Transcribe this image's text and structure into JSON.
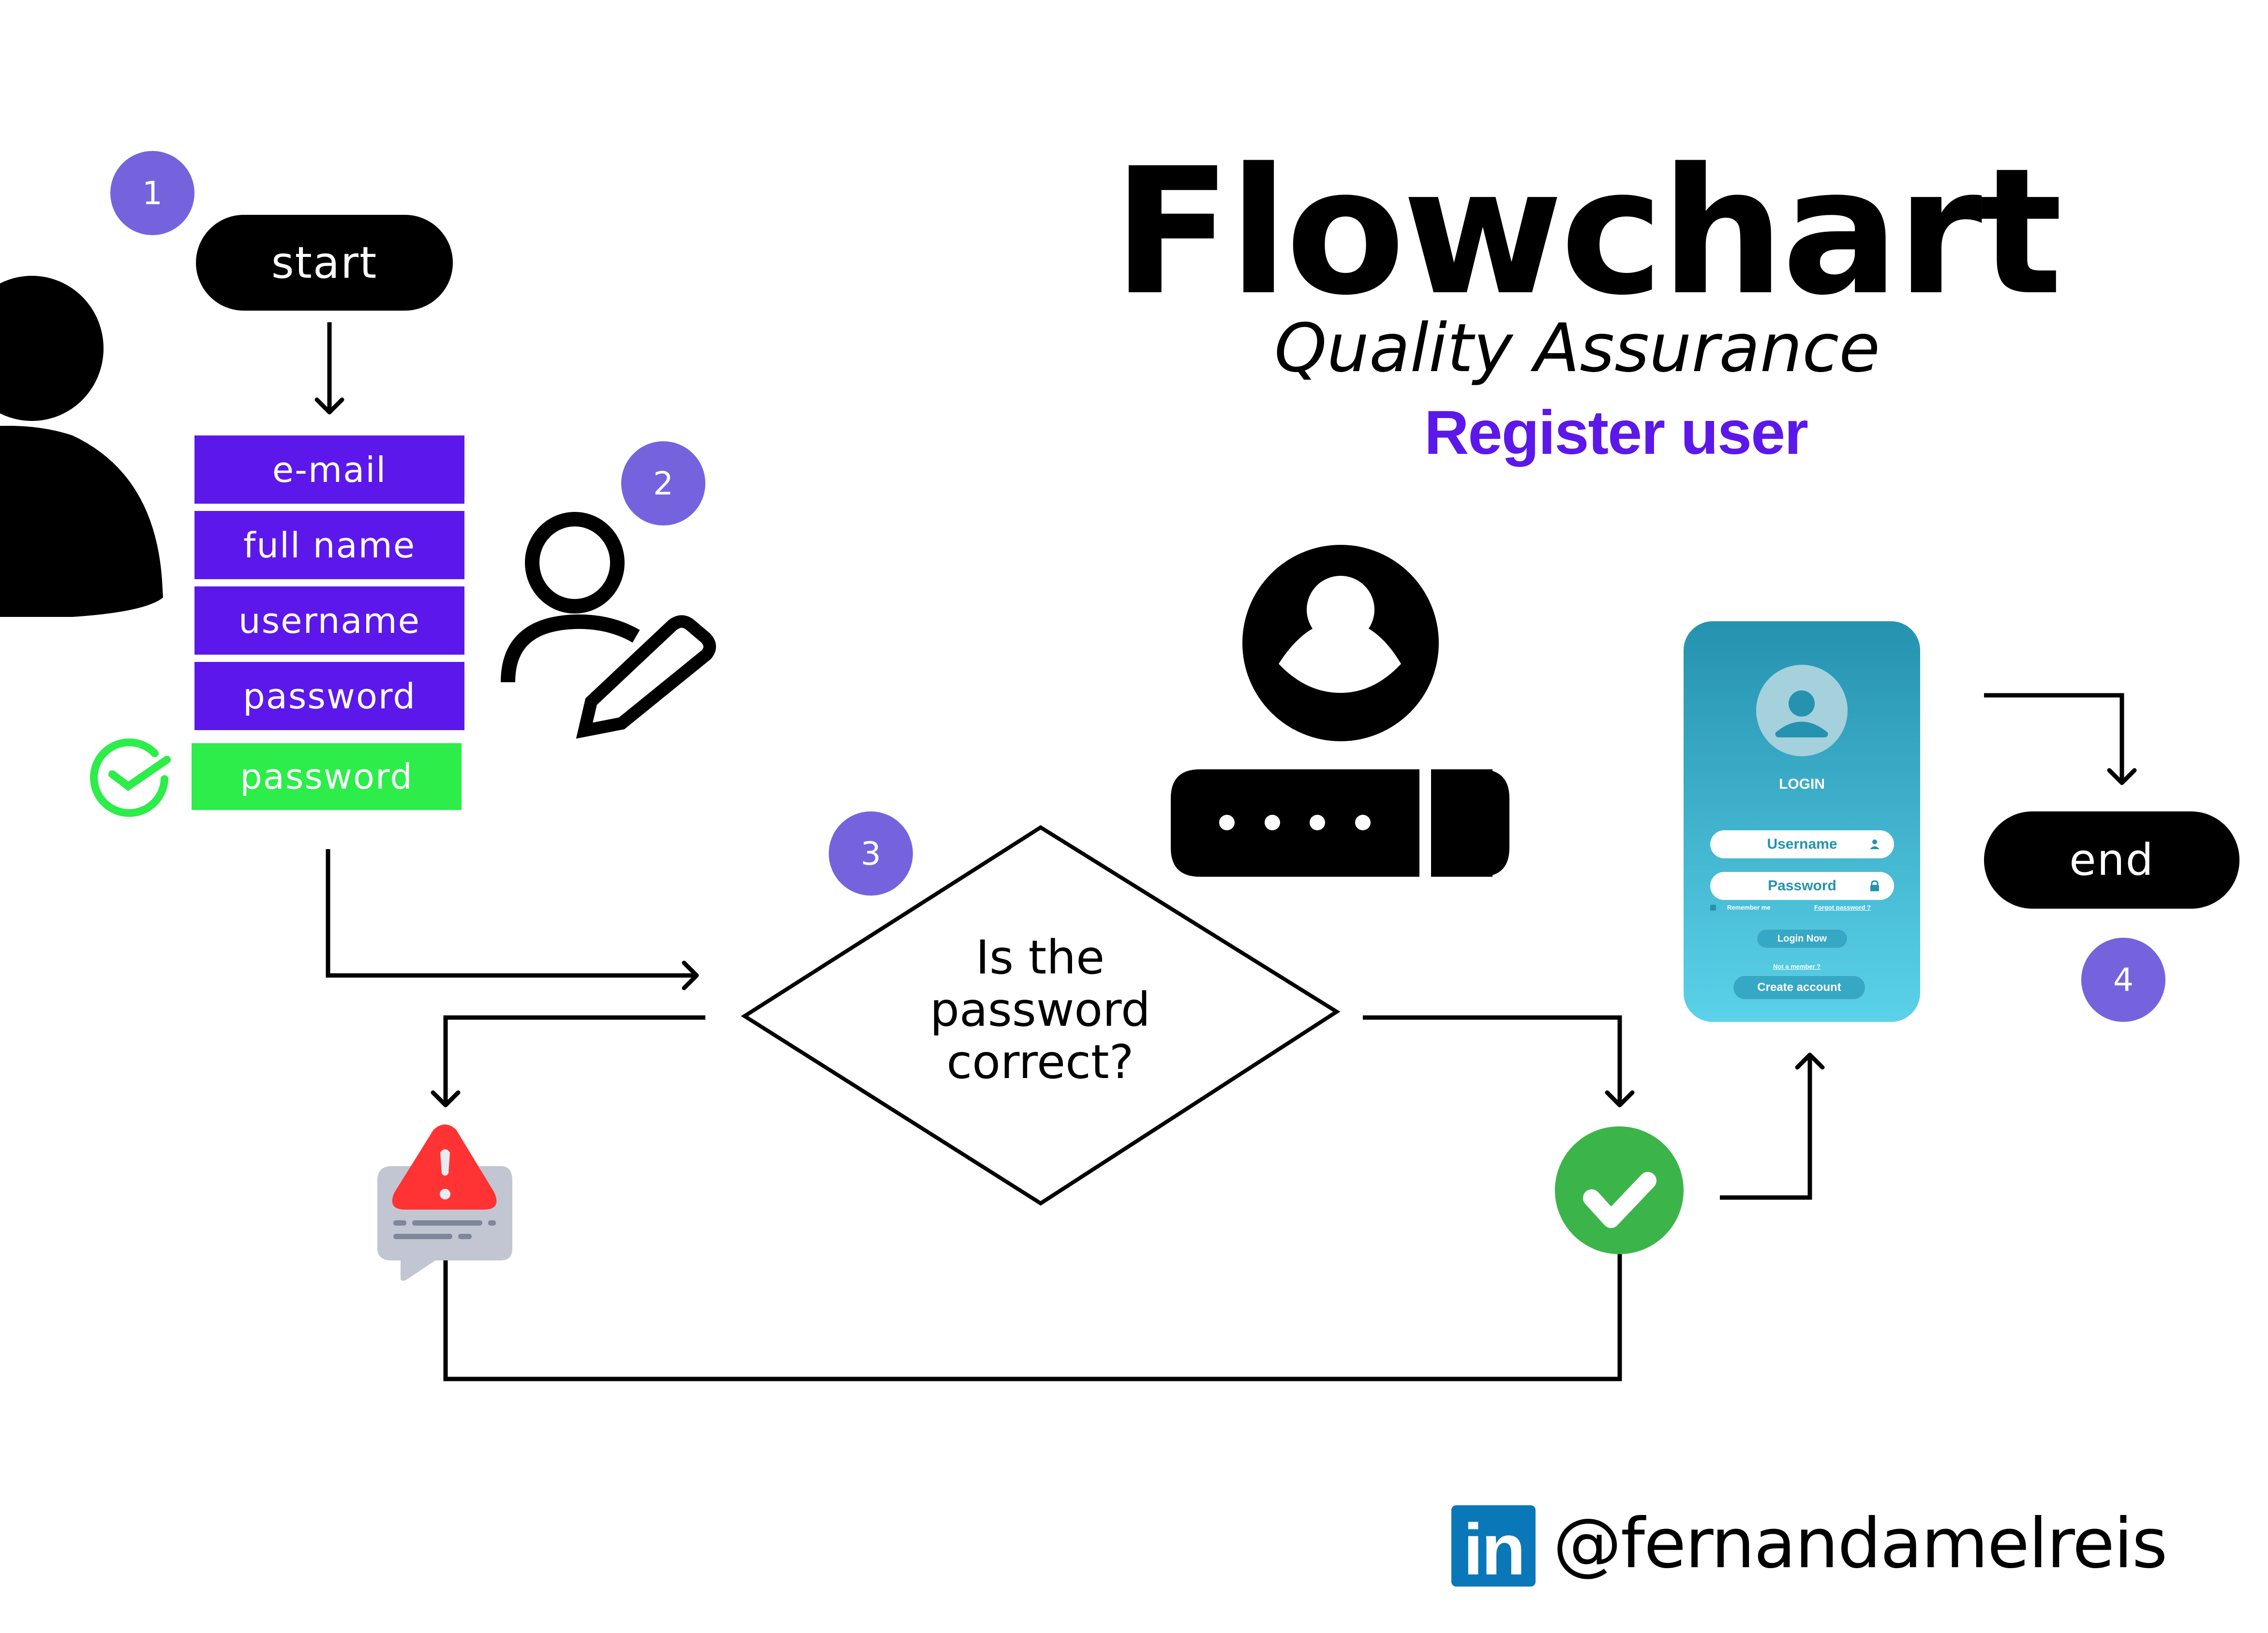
{
  "header": {
    "title": "Flowchart",
    "subtitle": "Quality Assurance",
    "topic": "Register user",
    "accent_color": "#5c18ea"
  },
  "steps": {
    "step1": "1",
    "step2": "2",
    "step3": "3",
    "step4": "4"
  },
  "terminals": {
    "start": "start",
    "end": "end"
  },
  "form_fields": [
    {
      "label": "e-mail",
      "state": "input"
    },
    {
      "label": "full name",
      "state": "input"
    },
    {
      "label": "username",
      "state": "input"
    },
    {
      "label": "password",
      "state": "input"
    },
    {
      "label": "password",
      "state": "confirmed"
    }
  ],
  "decision": {
    "line1": "Is the",
    "line2": "password",
    "line3": "correct?"
  },
  "outcomes": {
    "no": "error-alert",
    "yes": "success-check"
  },
  "login_screen": {
    "title": "LOGIN",
    "username_placeholder": "Username",
    "password_placeholder": "Password",
    "remember_me": "Remember me",
    "forgot_password": "Forgot password ?",
    "login_button": "Login Now",
    "not_member": "Not a member ?",
    "create_account": "Create account"
  },
  "footer": {
    "network_logo": "in",
    "handle": "@fernandamelreis"
  },
  "icons": {
    "user_silhouette": "user-icon",
    "user_edit": "user-edit-icon",
    "user_password": "user-password-icon",
    "confirm_check": "check-circle-outline-icon",
    "alert": "warning-message-icon",
    "success": "check-circle-icon",
    "linkedin": "linkedin-icon"
  },
  "colors": {
    "badge": "#7563de",
    "field": "#5c18ea",
    "field_confirmed": "#2ced4a",
    "success": "#3bb54a",
    "alert": "#ff3333",
    "linkedin": "#0a77b8"
  }
}
